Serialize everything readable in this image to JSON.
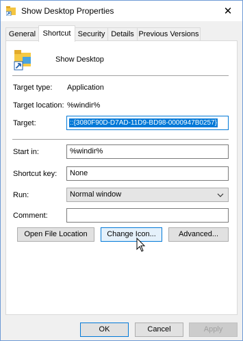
{
  "window": {
    "title": "Show Desktop Properties",
    "close_glyph": "✕"
  },
  "tabs": [
    {
      "label": "General"
    },
    {
      "label": "Shortcut"
    },
    {
      "label": "Security"
    },
    {
      "label": "Details"
    },
    {
      "label": "Previous Versions"
    }
  ],
  "header": {
    "name": "Show Desktop"
  },
  "info": {
    "target_type_label": "Target type:",
    "target_type_value": "Application",
    "target_location_label": "Target location:",
    "target_location_value": "%windir%",
    "target_label": "Target:",
    "target_value": "::{3080F90D-D7AD-11D9-BD98-0000947B0257}"
  },
  "form": {
    "start_in_label": "Start in:",
    "start_in_value": "%windir%",
    "shortcut_key_label": "Shortcut key:",
    "shortcut_key_value": "None",
    "run_label": "Run:",
    "run_value": "Normal window",
    "comment_label": "Comment:",
    "comment_value": ""
  },
  "actions": {
    "open_file_location": "Open File Location",
    "change_icon": "Change Icon...",
    "advanced": "Advanced..."
  },
  "footer": {
    "ok": "OK",
    "cancel": "Cancel",
    "apply": "Apply"
  },
  "colors": {
    "selection": "#0078d7",
    "window_border": "#6e9ad6",
    "panel_bg": "#ffffff",
    "dialog_bg": "#f0f0f0"
  }
}
